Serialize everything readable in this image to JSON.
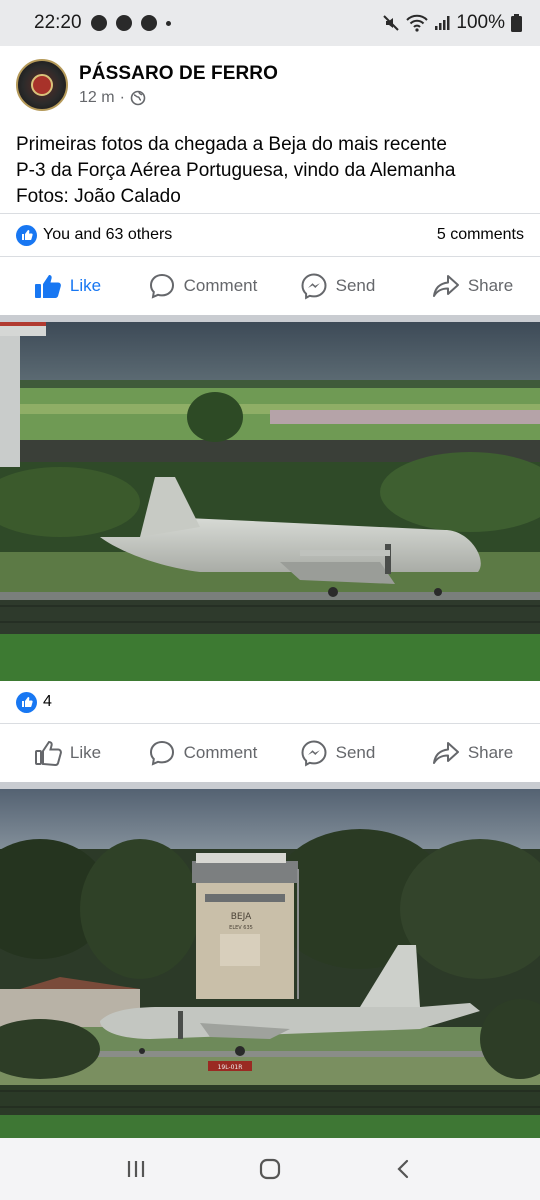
{
  "status_bar": {
    "time": "22:20",
    "battery": "100%"
  },
  "post": {
    "page_name": "PÁSSARO DE FERRO",
    "time_ago": "12 m",
    "separator": "·",
    "text_line1": "Primeiras fotos da chegada a Beja do mais recente",
    "text_line2": "P-3 da Força Aérea Portuguesa, vindo da Alemanha",
    "text_line3": "Fotos: João Calado",
    "reactions_text": "You and 63 others",
    "comments_text": "5 comments"
  },
  "actions_main": {
    "like": "Like",
    "comment": "Comment",
    "send": "Send",
    "share": "Share"
  },
  "photo1": {
    "reaction_count": "4"
  },
  "actions_photo1": {
    "like": "Like",
    "comment": "Comment",
    "send": "Send",
    "share": "Share"
  },
  "photo2": {
    "tower_label": "BEJA",
    "tower_sublabel": "ELEV 635",
    "runway_sign": "19L-01R"
  },
  "colors": {
    "brand_blue": "#1877f2",
    "muted_text": "#65676b"
  },
  "icons": [
    "wifi-icon",
    "mute-icon",
    "signal-icon",
    "battery-icon",
    "globe-icon",
    "like-icon",
    "comment-icon",
    "messenger-icon",
    "share-icon",
    "recent-apps-icon",
    "home-icon",
    "back-icon"
  ]
}
